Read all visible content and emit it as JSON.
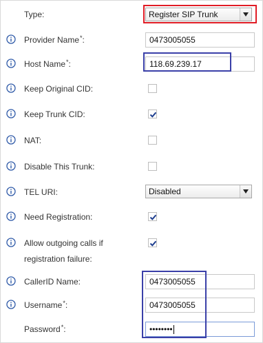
{
  "fields": {
    "type": {
      "label": "Type:",
      "value": "Register SIP Trunk"
    },
    "provider_name": {
      "label": "Provider Name",
      "required": "*",
      "colon": ":",
      "value": "0473005055"
    },
    "host_name": {
      "label": "Host Name",
      "required": "*",
      "colon": ":",
      "value": "118.69.239.17"
    },
    "keep_original_cid": {
      "label": "Keep Original CID:",
      "checked": false
    },
    "keep_trunk_cid": {
      "label": "Keep Trunk CID:",
      "checked": true
    },
    "nat": {
      "label": "NAT:",
      "checked": false
    },
    "disable_trunk": {
      "label": "Disable This Trunk:",
      "checked": false
    },
    "tel_uri": {
      "label": "TEL URI:",
      "value": "Disabled"
    },
    "need_registration": {
      "label": "Need Registration:",
      "checked": true
    },
    "allow_outgoing": {
      "label_line1": "Allow outgoing calls if",
      "label_line2": "registration failure:",
      "checked": true
    },
    "callerid_name": {
      "label": "CallerID Name:",
      "value": "0473005055"
    },
    "username": {
      "label": "Username",
      "required": "*",
      "colon": ":",
      "value": "0473005055"
    },
    "password": {
      "label": "Password",
      "required": "*",
      "colon": ":",
      "value": "••••••••"
    }
  },
  "icons": {
    "info": "info-icon",
    "dropdown": "dropdown-arrow-icon",
    "check": "checkmark-icon"
  },
  "colors": {
    "info_icon": "#2f5aa8",
    "checkmark": "#1f3f8f",
    "highlight_red": "#e01b24",
    "highlight_blue": "#3a3fa8"
  }
}
